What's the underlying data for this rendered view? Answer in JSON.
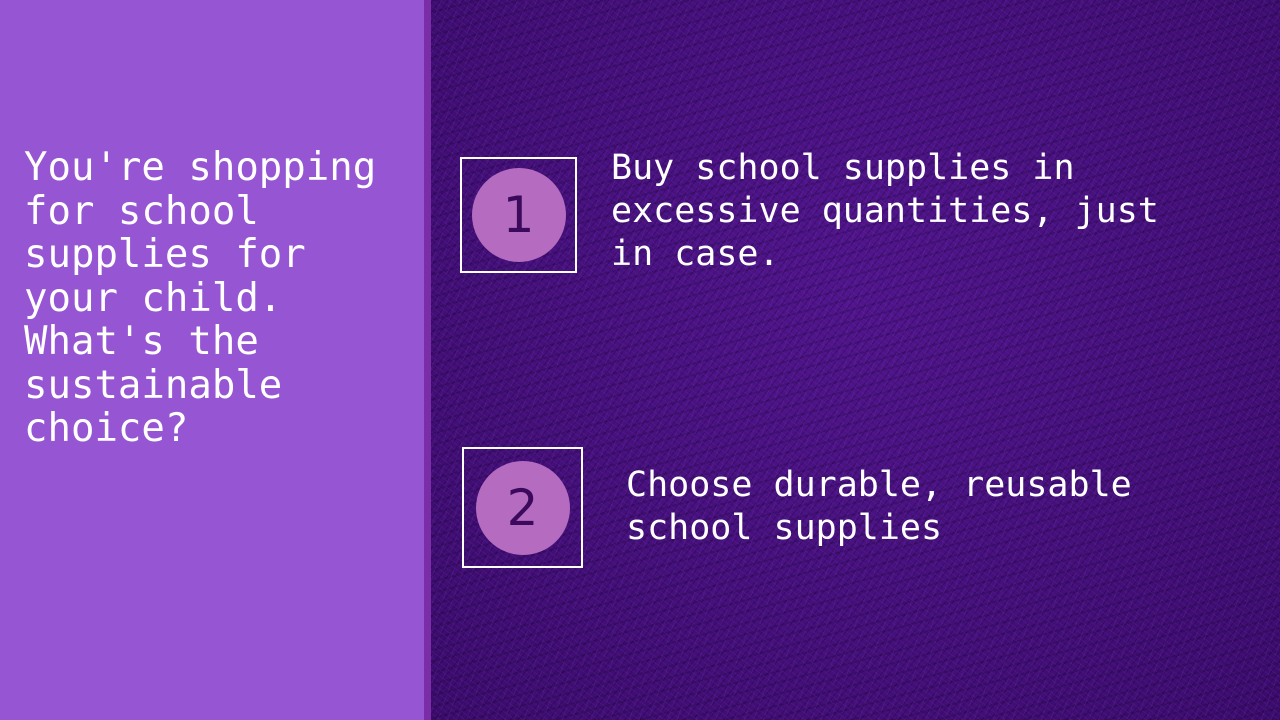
{
  "question": {
    "text": "You're shopping\nfor school\nsupplies for\nyour child.\nWhat's the\nsustainable\nchoice?"
  },
  "options": [
    {
      "number": "1",
      "text": "Buy school supplies in\nexcessive quantities, just\nin case."
    },
    {
      "number": "2",
      "text": "Choose durable, reusable\nschool supplies"
    }
  ],
  "colors": {
    "left_panel": "#9655d2",
    "right_panel": "#45107a",
    "circle": "#b56bbf",
    "number": "#3b0a5c",
    "text": "#ffffff"
  }
}
